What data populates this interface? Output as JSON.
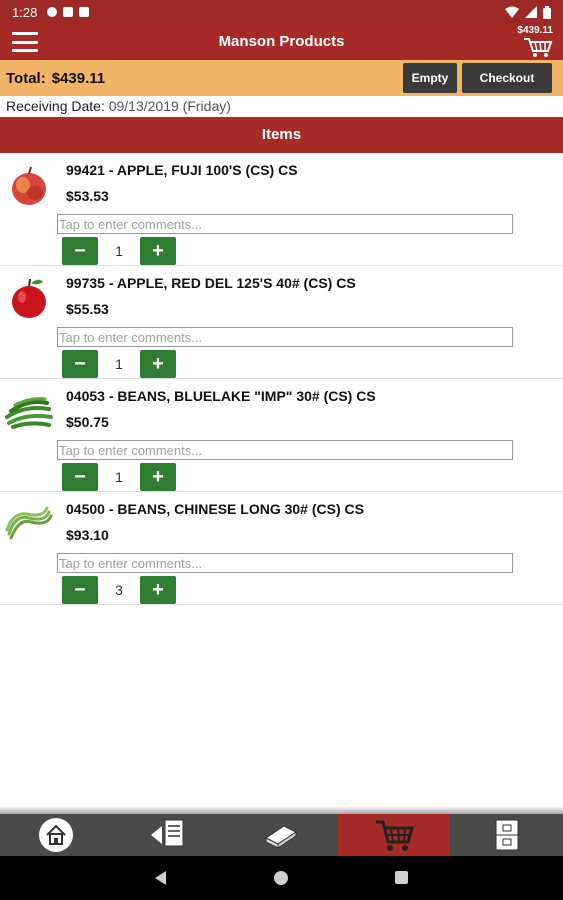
{
  "status_bar": {
    "time": "1:28"
  },
  "app": {
    "title": "Manson Products",
    "cart_total": "$439.11"
  },
  "summary": {
    "total_label": "Total:",
    "total_value": "$439.11",
    "empty_label": "Empty",
    "checkout_label": "Checkout"
  },
  "receiving": {
    "label": "Receiving Date:",
    "value": "09/13/2019 (Friday)"
  },
  "items_header": "Items",
  "items": [
    {
      "name": "99421 - APPLE, FUJI 100'S (CS) CS",
      "price": "$53.53",
      "comment_placeholder": "Tap to enter comments...",
      "qty": "1",
      "minus": "−",
      "plus": "+"
    },
    {
      "name": "99735 - APPLE, RED DEL 125'S 40# (CS) CS",
      "price": "$55.53",
      "comment_placeholder": "Tap to enter comments...",
      "qty": "1",
      "minus": "−",
      "plus": "+"
    },
    {
      "name": "04053 - BEANS, BLUELAKE \"IMP\" 30# (CS) CS",
      "price": "$50.75",
      "comment_placeholder": "Tap to enter comments...",
      "qty": "1",
      "minus": "−",
      "plus": "+"
    },
    {
      "name": "04500 - BEANS, CHINESE LONG 30# (CS) CS",
      "price": "$93.10",
      "comment_placeholder": "Tap to enter comments...",
      "qty": "3",
      "minus": "−",
      "plus": "+"
    }
  ],
  "bottom_nav": [
    {
      "icon": "home-icon"
    },
    {
      "icon": "order-guide-icon"
    },
    {
      "icon": "catalog-icon"
    },
    {
      "icon": "cart-icon",
      "active": true
    },
    {
      "icon": "account-icon"
    }
  ],
  "colors": {
    "brand_red": "#a62b27",
    "total_bar": "#f2b568",
    "stepper_green": "#2e7d32",
    "dark_button": "#3a3a3a"
  }
}
